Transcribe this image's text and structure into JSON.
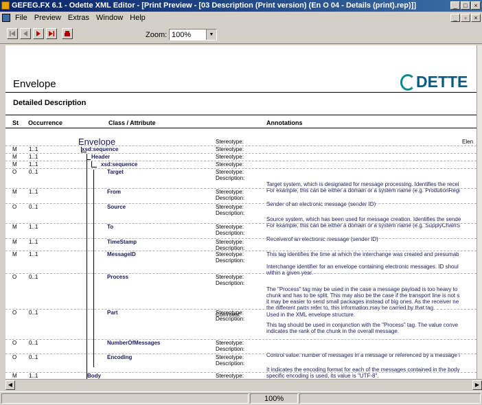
{
  "window": {
    "title": "GEFEG.FX 6.1 - Odette XML Editor - [Print Preview - [03 Description (Print version) (En O 04 - Details (print).rep)]]"
  },
  "menu": [
    "File",
    "Preview",
    "Extras",
    "Window",
    "Help"
  ],
  "toolbar": {
    "zoom_label": "Zoom:",
    "zoom_value": "100%"
  },
  "document": {
    "title": "Envelope",
    "logo_text": "DETTE",
    "section": "Detailed Description",
    "columns": {
      "st": "St",
      "occurrence": "Occurrence",
      "class_attribute": "Class / Attribute",
      "annotations": "Annotations"
    },
    "root_name": "Envelope",
    "root_stereotype_label": "Stereotype:",
    "root_stereotype_value": "Elen",
    "rows": [
      {
        "st": "M",
        "occ": "1..1",
        "name": "xsd:sequence",
        "labels": [
          "Stereotype:"
        ],
        "texts": []
      },
      {
        "st": "M",
        "occ": "1..1",
        "name": "Header",
        "labels": [
          "Stereotype:"
        ],
        "texts": []
      },
      {
        "st": "M",
        "occ": "1..1",
        "name": "xsd:sequence",
        "labels": [
          "Stereotype:"
        ],
        "texts": []
      },
      {
        "st": "O",
        "occ": "0..1",
        "name": "Target",
        "labels": [
          "Stereotype:",
          "Description:"
        ],
        "texts": [
          "Target system, which is designated for message processing. Identifies the recei",
          "For example, this can be either a domain or a system name (e.g. ProdutionRegi"
        ]
      },
      {
        "st": "M",
        "occ": "1..1",
        "name": "From",
        "labels": [
          "Stereotype:",
          "Description:"
        ],
        "texts": [
          "Sender of an electronic message (sender ID)"
        ]
      },
      {
        "st": "O",
        "occ": "0..1",
        "name": "Source",
        "labels": [
          "Stereotype:",
          "Description:"
        ],
        "texts": [
          "Source system, which has been used for message creation. Identifies the sende",
          "For example, this can be either a domain or a system name (e.g. SupplyChainS"
        ]
      },
      {
        "st": "M",
        "occ": "1..1",
        "name": "To",
        "labels": [
          "Stereotype:",
          "Description:"
        ],
        "texts": [
          "Receiverof an electronic message (sender ID)"
        ]
      },
      {
        "st": "M",
        "occ": "1..1",
        "name": "TimeStamp",
        "labels": [
          "Stereotype:",
          "Description:"
        ],
        "texts": [
          "This tag identifies the time at which the interchange was created and presumab"
        ]
      },
      {
        "st": "M",
        "occ": "1..1",
        "name": "MessageID",
        "labels": [
          "Stereotype:",
          "Description:"
        ],
        "texts": [
          "Interchange identifier for an envelope containing electronic messages. ID shoul",
          "within a given year."
        ]
      },
      {
        "st": "O",
        "occ": "0..1",
        "name": "Process",
        "labels": [
          "Stereotype:",
          "Description:"
        ],
        "texts": [
          "The \"Process\" tag may be used in the case a message payload is too heavy to",
          "chunk and has to be split. This may also be the case if the transport line is not s",
          "it may be easier to send small packages instead of big ones. As the receiver ne",
          "the different parts refer to, this information may be carried by that tag."
        ],
        "comment_label": "Comment:",
        "comment": "Used in the XML envelope structure."
      },
      {
        "st": "O",
        "occ": "0..1",
        "name": "Part",
        "labels": [
          "Stereotype:",
          "Description:"
        ],
        "texts": [
          "This tag should be used in conjunction with the \"Process\" tag.  The value conve",
          "indicates the rank of the chunk in the overall message."
        ]
      },
      {
        "st": "O",
        "occ": "0..1",
        "name": "NumberOfMessages",
        "labels": [
          "Stereotype:",
          "Description:"
        ],
        "texts": [
          "Control value: number of messages in a message or referenced by a message i"
        ]
      },
      {
        "st": "O",
        "occ": "0..1",
        "name": "Encoding",
        "labels": [
          "Stereotype:",
          "Description:"
        ],
        "texts": [
          "It indicates the encoding format for each of the messages contained in the body",
          "specific encoding is used, its value is \"UTF-8\"."
        ]
      },
      {
        "st": "M",
        "occ": "1..1",
        "name": "Body",
        "labels": [
          "Stereotype:"
        ],
        "texts": []
      }
    ]
  },
  "status": {
    "zoom": "100%"
  },
  "colors": {
    "name_blue": "#1a1a5e",
    "logo_blue": "#0a5a82",
    "titlebar": "#0a246a"
  }
}
